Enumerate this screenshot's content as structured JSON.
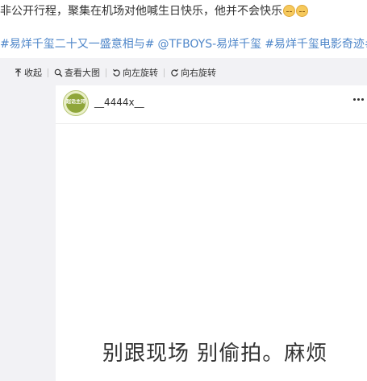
{
  "post": {
    "text": "非公开行程，聚集在机场对他喊生日快乐，他并不会快乐",
    "emoji_count": 2,
    "hashtags": [
      "#易烊千玺二十又一盛意相与#",
      "@TFBOYS-易烊千玺",
      "#易烊千玺电影奇迹#"
    ]
  },
  "toolbar": {
    "collapse_label": "收起",
    "view_large_label": "查看大图",
    "rotate_left_label": "向左旋转",
    "rotate_right_label": "向右旋转"
  },
  "card": {
    "avatar_text": "超话主持",
    "username": "__4444x__",
    "caption": "别跟现场 别偷拍。麻烦"
  },
  "colors": {
    "link_blue": "#4e86c9",
    "media_bg": "#f2f2f5",
    "text": "#333333"
  },
  "icons": [
    "collapse-arrow-icon",
    "magnifier-icon",
    "rotate-left-icon",
    "rotate-right-icon",
    "more-dots-icon",
    "emoji-face-icon"
  ]
}
